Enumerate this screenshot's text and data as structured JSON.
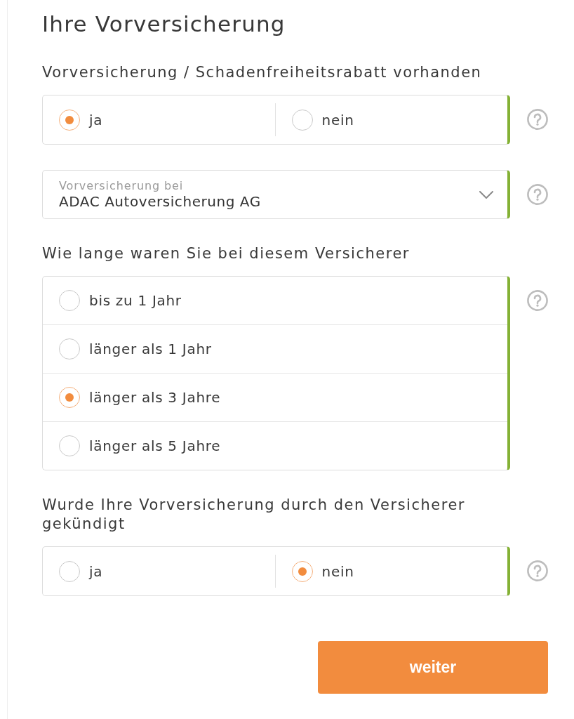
{
  "title": "Ihre Vorversicherung",
  "questions": [
    {
      "kind": "radio-inline",
      "label": "Vorversicherung / Schadenfreiheitsrabatt vorhanden",
      "valid": true,
      "options": [
        {
          "label": "ja",
          "selected": true
        },
        {
          "label": "nein",
          "selected": false
        }
      ]
    },
    {
      "kind": "select",
      "valid": true,
      "placeholder": "Vorversicherung bei",
      "value": "ADAC Autoversicherung AG"
    },
    {
      "kind": "radio-list",
      "label": "Wie lange waren Sie bei diesem Versicherer",
      "valid": true,
      "options": [
        {
          "label": "bis zu 1 Jahr",
          "selected": false
        },
        {
          "label": "länger als 1 Jahr",
          "selected": false
        },
        {
          "label": "länger als 3 Jahre",
          "selected": true
        },
        {
          "label": "länger als 5 Jahre",
          "selected": false
        }
      ]
    },
    {
      "kind": "radio-inline",
      "label": "Wurde Ihre Vorversicherung durch den Versicherer gekündigt",
      "valid": true,
      "options": [
        {
          "label": "ja",
          "selected": false
        },
        {
          "label": "nein",
          "selected": true
        }
      ]
    }
  ],
  "button": {
    "label": "weiter"
  }
}
